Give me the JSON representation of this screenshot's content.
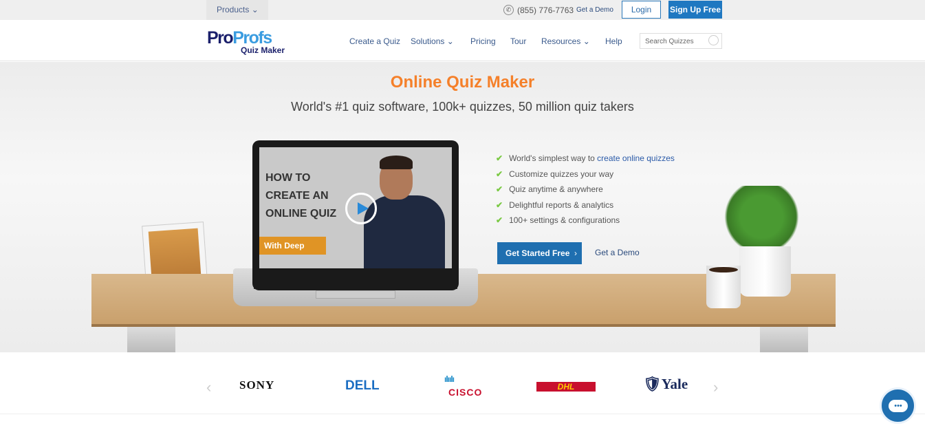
{
  "topbar": {
    "products": "Products",
    "phone": "(855) 776-7763",
    "demo": "Get a Demo",
    "login": "Login",
    "signup": "Sign Up Free"
  },
  "nav": {
    "logo_pro": "Pro",
    "logo_profs": "Profs",
    "logo_sub": "Quiz Maker",
    "items": [
      "Create a Quiz",
      "Solutions",
      "Pricing",
      "Tour",
      "Resources",
      "Help"
    ],
    "search_placeholder": "Search Quizzes"
  },
  "hero": {
    "title": "Online Quiz Maker",
    "subtitle": "World's #1 quiz software, 100k+ quizzes, 50 million quiz takers",
    "video": {
      "line1": "HOW TO",
      "line2": "CREATE AN",
      "line3": "ONLINE QUIZ",
      "badge": "With Deep"
    },
    "features": [
      {
        "text": "World's simplest way to ",
        "link": "create online quizzes"
      },
      {
        "text": "Customize quizzes your way"
      },
      {
        "text": "Quiz anytime & anywhere"
      },
      {
        "text": "Delightful reports & analytics"
      },
      {
        "text": "100+ settings & configurations"
      }
    ],
    "cta_primary": "Get Started Free",
    "cta_secondary": "Get a Demo"
  },
  "logos": [
    "SONY",
    "DELL",
    "CISCO",
    "DHL",
    "Yale"
  ],
  "colors": {
    "accent": "#f5802a",
    "primary": "#1f78c1",
    "check": "#7ac943"
  }
}
